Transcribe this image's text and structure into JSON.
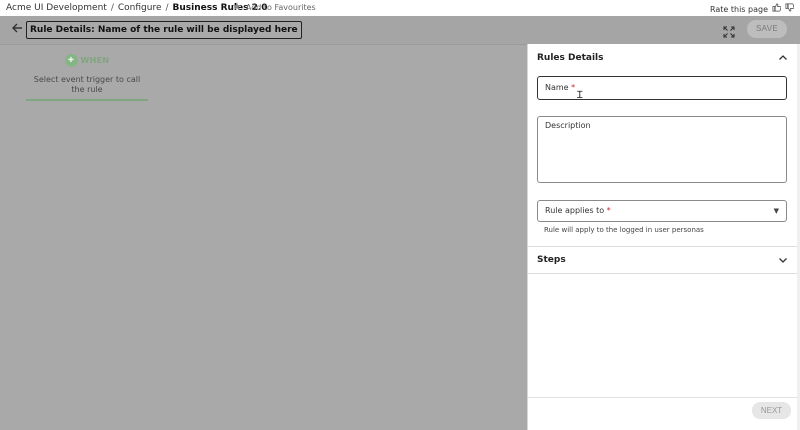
{
  "breadcrumb": {
    "items": [
      "Acme UI Development",
      "Configure",
      "Business Rules 2.0"
    ],
    "separator": "/"
  },
  "favourites": {
    "label": "Add to Favourites",
    "icon": "star-icon"
  },
  "rating": {
    "label": "Rate this page",
    "icons": [
      "thumbs-up-icon",
      "thumbs-down-icon"
    ]
  },
  "header": {
    "title": "Rule Details: Name of the rule will be displayed here",
    "save_label": "SAVE"
  },
  "trigger": {
    "badge": "WHEN",
    "text": "Select event trigger to call the rule"
  },
  "panel": {
    "rules_details_title": "Rules Details",
    "name_label": "Name",
    "required_mark": "*",
    "description_label": "Description",
    "applies_label": "Rule applies to",
    "applies_helper": "Rule will apply to the logged in user personas",
    "steps_title": "Steps",
    "next_label": "NEXT"
  },
  "colors": {
    "overlay": "#a9a9a9",
    "accent_green": "#85b585",
    "required": "#c62828"
  }
}
